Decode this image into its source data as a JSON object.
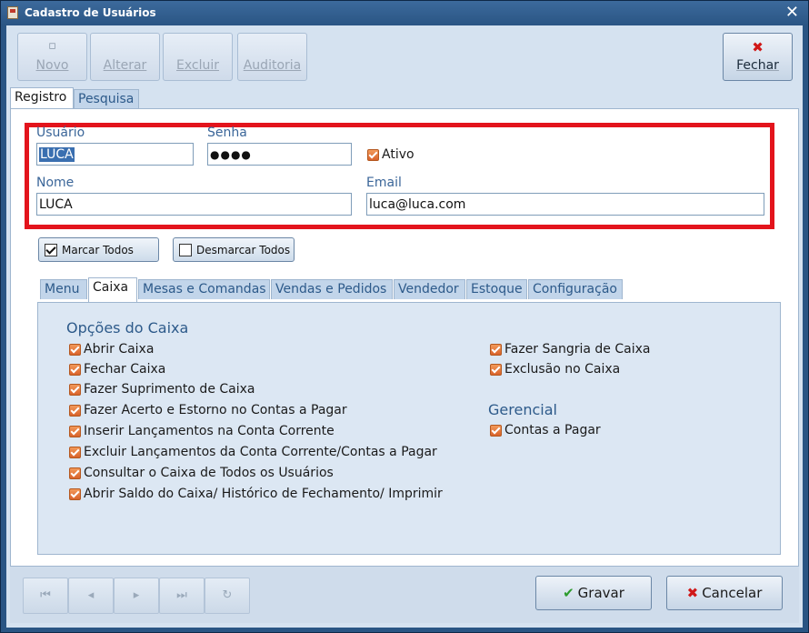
{
  "window": {
    "title": "Cadastro de Usuários"
  },
  "toolbar": {
    "novo": "Novo",
    "alterar": "Alterar",
    "excluir": "Excluir",
    "auditoria": "Auditoria",
    "fechar": "Fechar"
  },
  "main_tabs": [
    "Registro",
    "Pesquisa"
  ],
  "form": {
    "usuario_label": "Usuário",
    "usuario_value": "LUCA",
    "senha_label": "Senha",
    "senha_value": "●●●●",
    "ativo_label": "Ativo",
    "nome_label": "Nome",
    "nome_value": "LUCA",
    "email_label": "Email",
    "email_value": "luca@luca.com"
  },
  "actions": {
    "marcar_todos": "Marcar Todos",
    "desmarcar_todos": "Desmarcar Todos"
  },
  "perm_tabs": [
    "Menu",
    "Caixa",
    "Mesas e Comandas",
    "Vendas e Pedidos",
    "Vendedor",
    "Estoque",
    "Configuração"
  ],
  "caixa": {
    "section_title": "Opções do Caixa",
    "left_options": [
      "Abrir Caixa",
      "Fechar Caixa",
      "Fazer Suprimento de Caixa",
      "Fazer Acerto e Estorno no Contas a Pagar",
      "Inserir Lançamentos na Conta Corrente",
      "Excluir Lançamentos da Conta Corrente/Contas a Pagar",
      "Consultar o Caixa de Todos os Usuários",
      "Abrir Saldo do Caixa/ Histórico de Fechamento/ Imprimir"
    ],
    "right_options": [
      "Fazer Sangria de Caixa",
      "Exclusão no Caixa"
    ],
    "gerencial_title": "Gerencial",
    "gerencial_options": [
      "Contas a Pagar"
    ]
  },
  "bottom": {
    "nav": [
      "first-icon",
      "prev-icon",
      "next-icon",
      "last-icon",
      "refresh-icon"
    ],
    "gravar": "Gravar",
    "cancelar": "Cancelar"
  },
  "colors": {
    "accent": "#2a5584",
    "highlight_box": "#e3141c",
    "checkbox": "#e06a2e"
  }
}
